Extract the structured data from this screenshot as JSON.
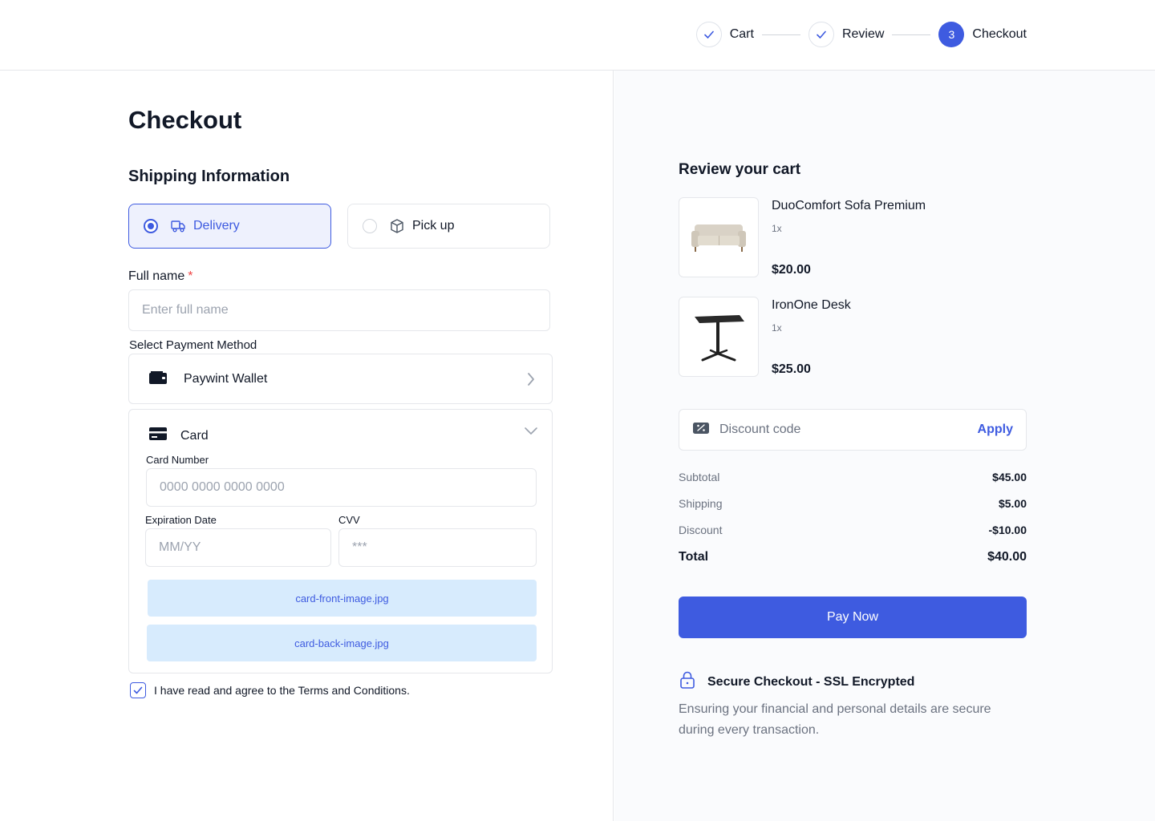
{
  "stepper": {
    "steps": [
      {
        "label": "Cart",
        "state": "done"
      },
      {
        "label": "Review",
        "state": "done"
      },
      {
        "label": "Checkout",
        "state": "active",
        "number": "3"
      }
    ]
  },
  "checkout": {
    "title": "Checkout",
    "shipping_title": "Shipping Information",
    "shipping_options": [
      {
        "label": "Delivery",
        "icon": "truck-icon",
        "selected": true
      },
      {
        "label": "Pick up",
        "icon": "box-icon",
        "selected": false
      }
    ],
    "full_name": {
      "label": "Full name",
      "required_mark": "*",
      "placeholder": "Enter full name",
      "value": ""
    },
    "payment_title": "Select Payment Method",
    "wallet": {
      "label": "Paywint Wallet",
      "icon": "wallet-icon"
    },
    "card": {
      "label": "Card",
      "icon": "credit-card-icon",
      "number_label": "Card Number",
      "number_placeholder": "0000 0000 0000 0000",
      "expiry_label": "Expiration Date",
      "expiry_placeholder": "MM/YY",
      "cvv_label": "CVV",
      "cvv_placeholder": "***",
      "front_file": "card-front-image.jpg",
      "back_file": "card-back-image.jpg"
    },
    "terms": {
      "text": "I have read and agree to the Terms and Conditions.",
      "checked": true
    }
  },
  "cart": {
    "title": "Review your cart",
    "items": [
      {
        "name": "DuoComfort Sofa Premium",
        "qty": "1x",
        "price": "$20.00",
        "image": "sofa-image"
      },
      {
        "name": "IronOne Desk",
        "qty": "1x",
        "price": "$25.00",
        "image": "desk-image"
      }
    ],
    "discount": {
      "placeholder": "Discount code",
      "apply_label": "Apply",
      "icon": "discount-tag-icon"
    },
    "summary": [
      {
        "label": "Subtotal",
        "value": "$45.00"
      },
      {
        "label": "Shipping",
        "value": "$5.00"
      },
      {
        "label": "Discount",
        "value": "-$10.00"
      }
    ],
    "total": {
      "label": "Total",
      "value": "$40.00"
    },
    "pay_label": "Pay Now",
    "secure": {
      "title": "Secure Checkout - SSL Encrypted",
      "desc": "Ensuring your financial and personal details are secure during every transaction.",
      "icon": "lock-icon"
    }
  },
  "colors": {
    "accent": "#3e5be0",
    "upload_bg": "#d7ebfd",
    "panel_bg": "#fafbfd"
  }
}
